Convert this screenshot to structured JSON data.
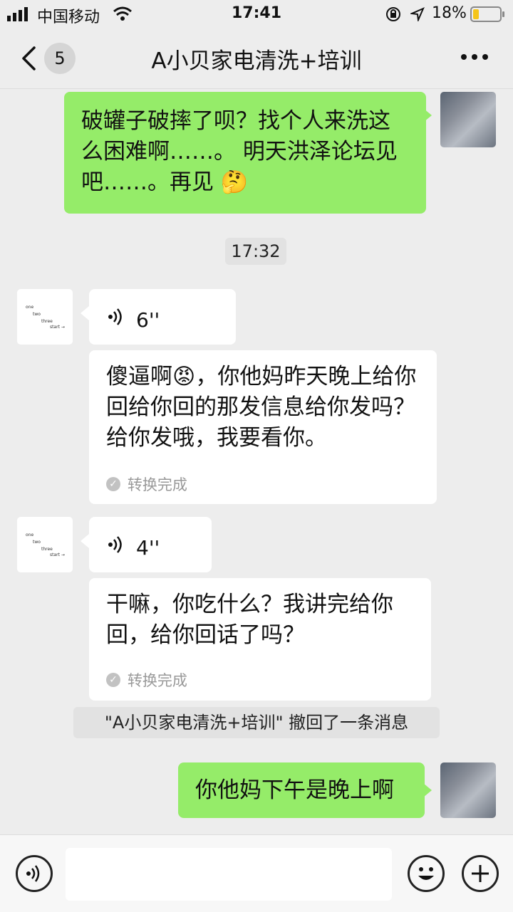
{
  "status_bar": {
    "carrier": "中国移动",
    "time": "17:41",
    "battery": "18%"
  },
  "nav": {
    "unread_count": "5",
    "title": "A小贝家电清洗+培训"
  },
  "messages": {
    "m1": "破罐子破摔了呗？找个人来洗这么困难啊……。 明天洪泽论坛见吧……。再见",
    "ts1": "17:32",
    "voice1_duration": "6''",
    "voice1_text": "傻逼啊😡，你他妈昨天晚上给你回给你回的那发信息给你发吗？给你发哦，我要看你。",
    "voice1_status": "转换完成",
    "voice2_duration": "4''",
    "voice2_text": "干嘛，你吃什么？我讲完给你回，给你回话了吗？",
    "voice2_status": "转换完成",
    "recall_notice": "\"A小贝家电清洗+培训\" 撤回了一条消息",
    "m2": "你他妈下午是晚上啊"
  },
  "other_avatar_lines": [
    "one",
    "two",
    "three",
    "start →"
  ],
  "colors": {
    "my_bubble": "#95ec69",
    "their_bubble": "#ffffff",
    "background": "#ededed"
  },
  "icons": [
    "signal-icon",
    "wifi-icon",
    "lock-rotation-icon",
    "location-icon",
    "battery-icon",
    "back-chevron-icon",
    "more-icon",
    "voice-wave-icon",
    "smiley-icon",
    "check-icon",
    "emoji-icon",
    "plus-icon"
  ]
}
